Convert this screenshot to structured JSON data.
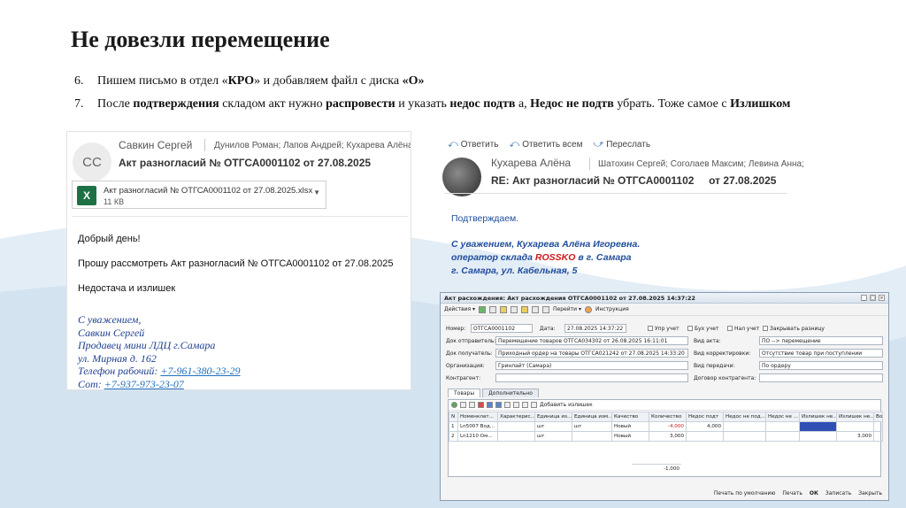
{
  "slide": {
    "title": "Не довезли перемещение",
    "bullets": [
      {
        "num": "6.",
        "parts": [
          "Пишем письмо в отдел «",
          "КРО",
          "» и добавляем файл с диска ",
          "«О»",
          ""
        ]
      },
      {
        "num": "7.",
        "parts": [
          "После ",
          "подтверждения",
          " складом акт нужно ",
          "распровести",
          " и указать ",
          "недос подтв",
          " а, ",
          "Недос не подтв",
          " убрать. Тоже самое с ",
          "Излишком",
          ""
        ]
      }
    ]
  },
  "email1": {
    "avatar": "СС",
    "from": "Савкин Сергей",
    "to": "Дунилов Роман; Лапов Андрей; Кухарева Алёна; Кра",
    "subject": "Акт разногласий № ОТГСА0001102 от 27.08.2025",
    "attachment": {
      "name": "Акт разногласий № ОТГСА0001102 от 27.08.2025.xlsx",
      "size": "11 КВ",
      "icon": "excel-icon"
    },
    "greeting": "Добрый день!",
    "request": "Прошу рассмотреть Акт разногласий № ОТГСА0001102 от 27.08.2025",
    "topic": "Недостача и излишек",
    "signature": {
      "line1": "С уважением,",
      "line2": "Савкин Сергей",
      "line3": "Продавец мини ЛДЦ г.Самара",
      "line4": "ул. Мирная д. 162",
      "phone_label": "Телефон рабочий: ",
      "phone": "+7-961-380-23-29",
      "mobile_label": "Сот: ",
      "mobile": "+7-937-973-23-07"
    }
  },
  "email2": {
    "actions": [
      "Ответить",
      "Ответить всем",
      "Переслать"
    ],
    "from": "Кухарева Алёна",
    "to": "Шатохин Сергей; Соголаев Максим; Левина Анна;",
    "subject": "RE: Акт разногласий № ОТГСА0001102",
    "subject_date": "от 27.08.2025",
    "body": "Подтверждаем.",
    "sig1": "С уважением, Кухарева Алёна Игоревна.",
    "sig2_a": "оператор склада ",
    "sig2_red": "ROSSKO",
    "sig2_b": " в г. Самара",
    "sig3": "г. Самара, ул. Кабельная, 5"
  },
  "doc": {
    "title": "Акт расхождения: Акт расхождения ОТГСА0001102 от 27.08.2025 14:37:22",
    "toolbar": {
      "actions": "Действия ▾",
      "goto": "Перейти ▾",
      "help": "Инструкция"
    },
    "fields": {
      "number_label": "Номер:",
      "number": "ОТГСА0001102",
      "date_label": "Дата:",
      "date": "27.08.2025 14:37:22",
      "upr": "Упр учет",
      "buh": "Бух учет",
      "nal": "Нал учет",
      "close": "Закрывать разницу",
      "sender_label": "Док отправитель:",
      "sender": "Перемещение товаров ОТГСА034302 от 26.08.2025 16:11:01",
      "receiver_label": "Док получатель:",
      "receiver": "Приходный ордер на товары ОТГСА021242 от 27.08.2025 14:33:20",
      "org_label": "Организация:",
      "org": "Гринлайт (Самара)",
      "contr_label": "Контрагент:",
      "act_kind_label": "Вид акта:",
      "act_kind": "ПО --> перемещение",
      "corr_label": "Вид корректировки:",
      "corr": "Отсутствие товар при поступлении",
      "transfer_label": "Вид передачи:",
      "transfer": "По ордеру",
      "contract_label": "Договор контрагента:"
    },
    "tabs": [
      "Товары",
      "Дополнительно"
    ],
    "grid_add": "Добавить излишек",
    "columns": [
      "N",
      "Номенклат...",
      "Характерис...",
      "Единица из...",
      "Единица изм...",
      "Качество",
      "Количество",
      "Недос подт",
      "Недос не под...",
      "Недос не ...",
      "Излишек не...",
      "Излишек не...",
      "Во"
    ],
    "rows": [
      [
        "1",
        "Ln5007 Вод...",
        "",
        "шт",
        "шт",
        "Новый",
        "-4,000",
        "4,000",
        "",
        "",
        "",
        "",
        ""
      ],
      [
        "2",
        "Ln1210 Ом...",
        "",
        "шт",
        "",
        "Новый",
        "3,000",
        "",
        "",
        "",
        "",
        "3,000",
        ""
      ]
    ],
    "total": "-1,000",
    "bottom": [
      "Печать по умолчанию",
      "Печать",
      "ОК",
      "Записать",
      "Закрыть"
    ]
  }
}
